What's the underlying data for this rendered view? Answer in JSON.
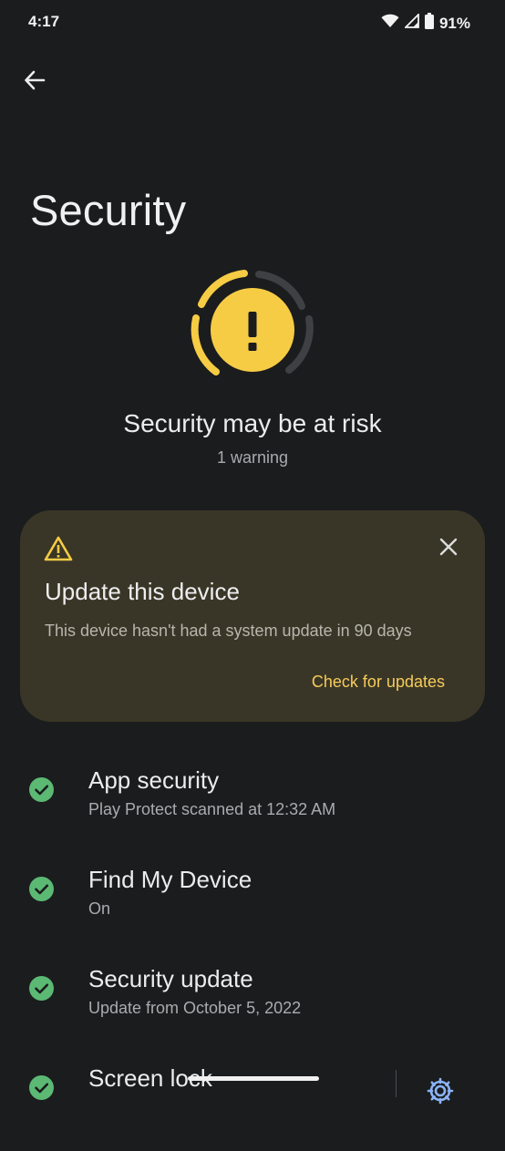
{
  "status_bar": {
    "time": "4:17",
    "battery": "91%",
    "icons": [
      "wifi-icon",
      "signal-icon",
      "battery-icon"
    ]
  },
  "header": {
    "back_icon": "arrow-left-icon",
    "title": "Security"
  },
  "summary": {
    "heading": "Security may be at risk",
    "subtext": "1 warning",
    "ring_icon": "exclamation-icon",
    "accent_color": "#f6cc44"
  },
  "warning_card": {
    "icon": "warning-triangle-icon",
    "close_icon": "close-icon",
    "title": "Update this device",
    "body": "This device hasn't had a system update in 90 days",
    "action": "Check for updates",
    "background_color": "#3a3627",
    "action_color": "#f6cc59"
  },
  "items": [
    {
      "title": "App security",
      "subtitle": "Play Protect scanned at 12:32 AM",
      "icon": "check-circle-icon"
    },
    {
      "title": "Find My Device",
      "subtitle": "On",
      "icon": "check-circle-icon"
    },
    {
      "title": "Security update",
      "subtitle": "Update from October 5, 2022",
      "icon": "check-circle-icon"
    },
    {
      "title": "Screen lock",
      "subtitle": "",
      "icon": "check-circle-icon",
      "secondary_icon": "gear-icon"
    }
  ],
  "colors": {
    "background": "#1b1c1e",
    "success": "#5bb974"
  }
}
